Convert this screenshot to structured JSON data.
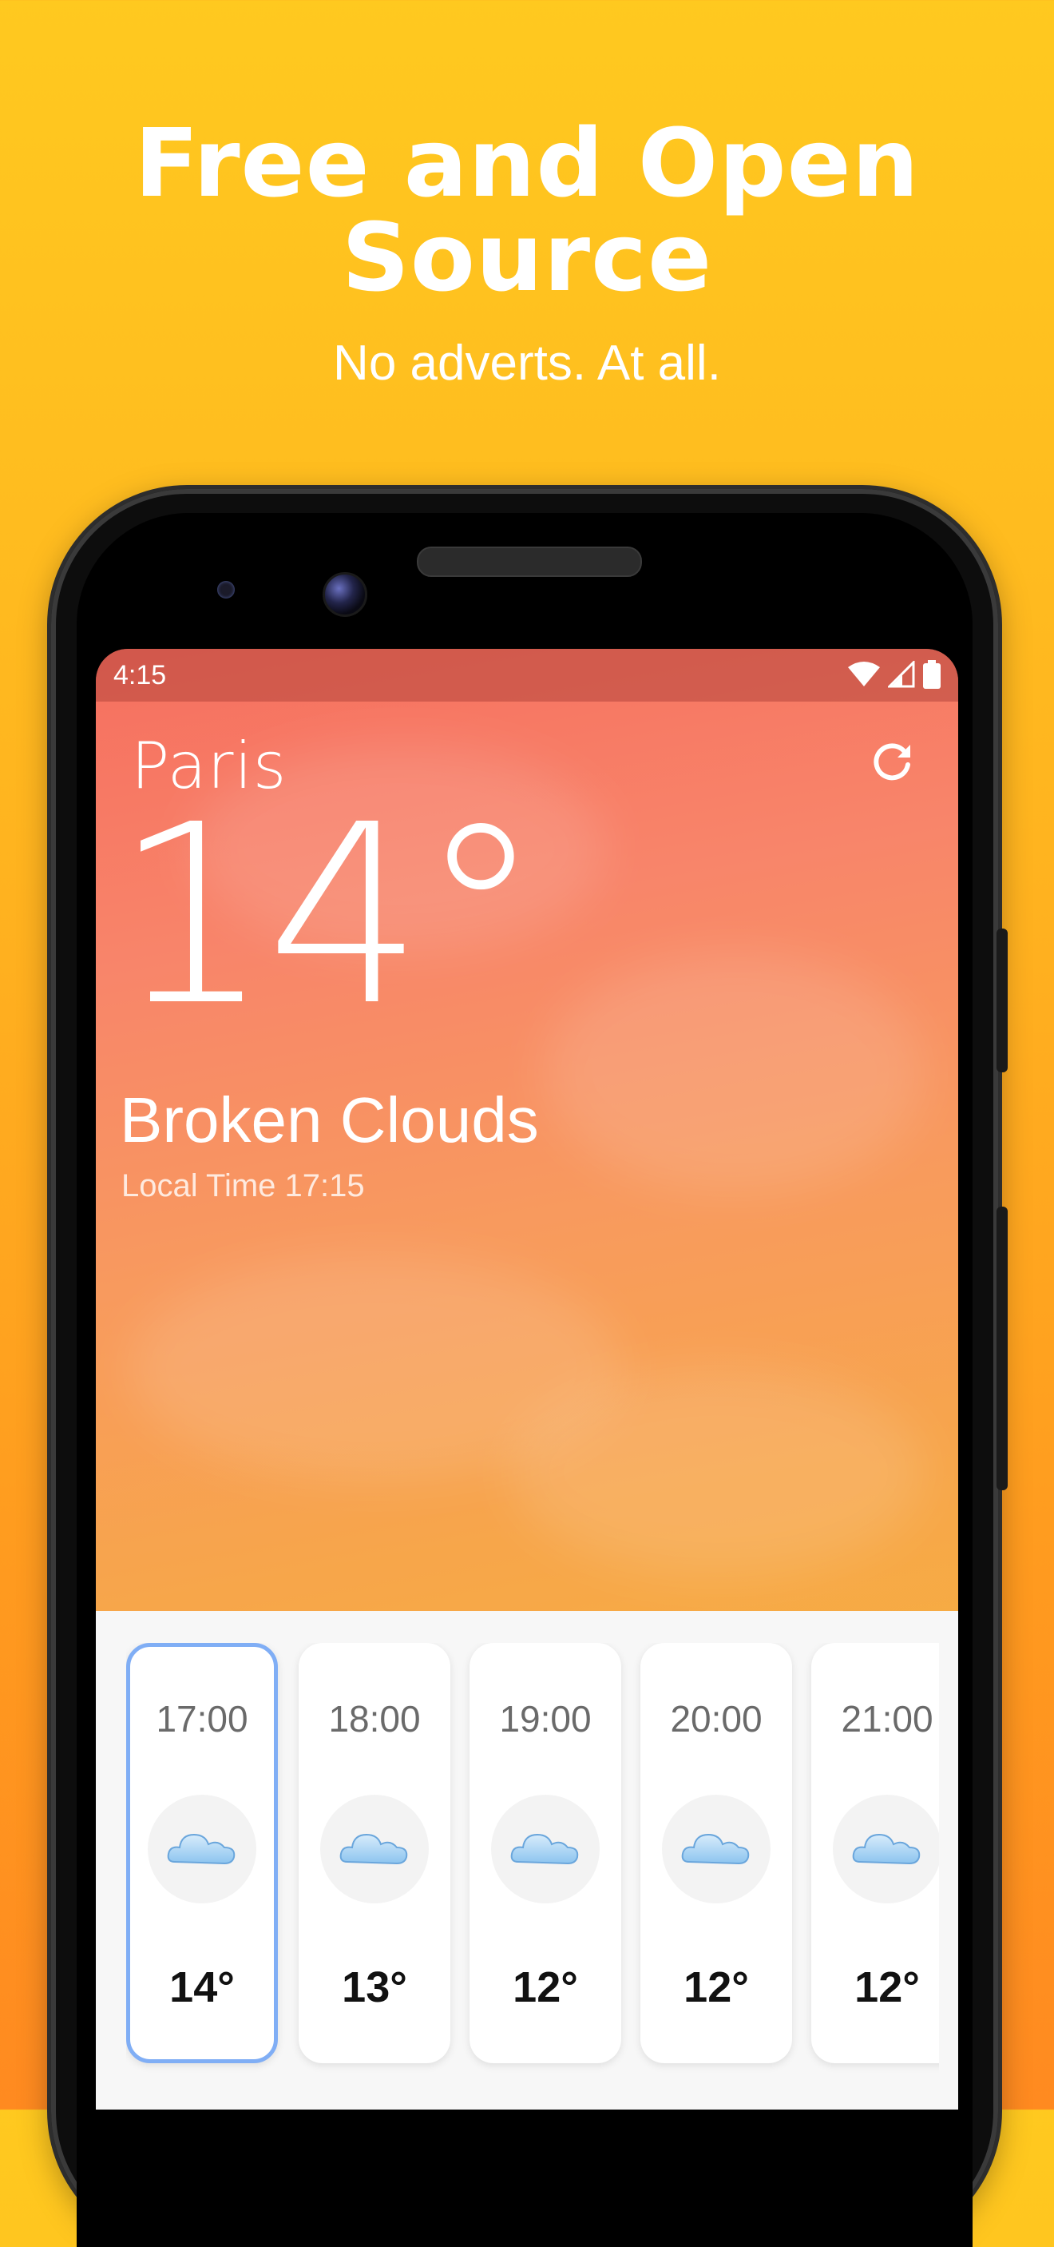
{
  "promo": {
    "title_line1": "Free and Open",
    "title_line2": "Source",
    "subtitle": "No adverts. At all."
  },
  "status_bar": {
    "time": "4:15",
    "icons": [
      "wifi-icon",
      "cell-signal-icon",
      "battery-icon"
    ]
  },
  "weather": {
    "city": "Paris",
    "temperature": "14°",
    "condition": "Broken Clouds",
    "local_time": "Local Time 17:15",
    "refresh_icon": "refresh-icon"
  },
  "forecast": [
    {
      "time": "17:00",
      "icon": "cloud-icon",
      "temp": "14°",
      "selected": true
    },
    {
      "time": "18:00",
      "icon": "cloud-icon",
      "temp": "13°",
      "selected": false
    },
    {
      "time": "19:00",
      "icon": "cloud-icon",
      "temp": "12°",
      "selected": false
    },
    {
      "time": "20:00",
      "icon": "cloud-icon",
      "temp": "12°",
      "selected": false
    },
    {
      "time": "21:00",
      "icon": "cloud-icon",
      "temp": "12°",
      "selected": false
    }
  ],
  "colors": {
    "background_top": "#ffc91f",
    "background_bottom": "#ff8a20",
    "sky_top": "#f66f5f",
    "sky_bottom": "#f6b83a",
    "selected_border": "#80aef5"
  }
}
